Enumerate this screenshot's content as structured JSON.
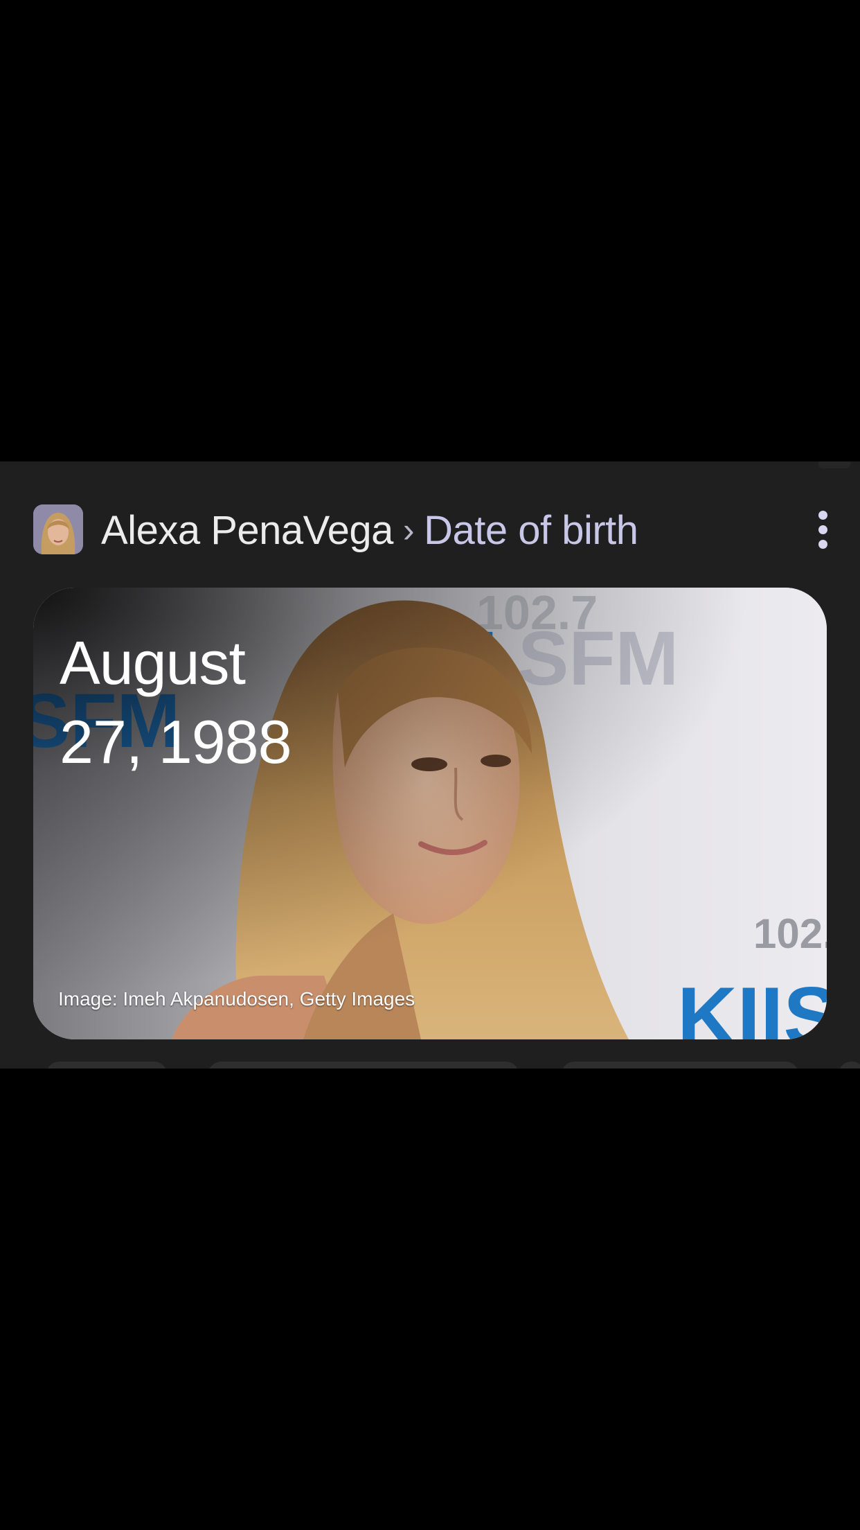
{
  "header": {
    "entity": "Alexa PenaVega",
    "separator": "›",
    "attribute": "Date of birth"
  },
  "answer": {
    "line1": "August",
    "line2": "27, 1988"
  },
  "image": {
    "credit": "Image: Imeh Akpanudosen, Getty Images",
    "backdrop_text": [
      "102.7",
      "KIIS",
      "FM"
    ],
    "backdrop_text_color": "#1f78c4"
  },
  "colors": {
    "panel_bg": "#1f1f1f",
    "accent": "#c9c7e8",
    "text": "#ececec"
  },
  "icons": {
    "menu": "more-vert-icon"
  }
}
